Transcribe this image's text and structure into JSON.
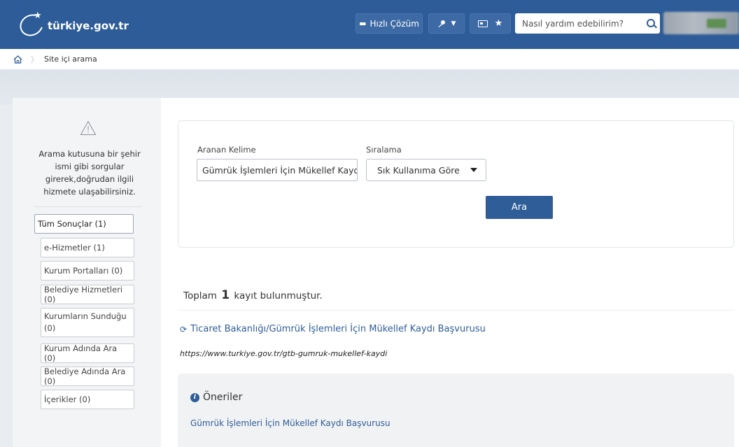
{
  "header": {
    "logo_text": "türkiye.gov.tr",
    "hizli_cozum": "Hızlı Çözüm",
    "search_placeholder": "Nasıl yardım edebilirim?"
  },
  "breadcrumb": {
    "current": "Site içi arama"
  },
  "sidebar": {
    "message": "Arama kutusuna bir şehir ismi gibi sorgular girerek,doğrudan ilgili hizmete ulaşabilirsiniz.",
    "filters": [
      {
        "label": "Tüm Sonuçlar (1)"
      },
      {
        "label": "e-Hizmetler (1)"
      },
      {
        "label": "Kurum Portalları (0)"
      },
      {
        "label": "Belediye Hizmetleri (0)"
      },
      {
        "label": "Kurumların Sunduğu (0)"
      },
      {
        "label": "Kurum Adında Ara (0)"
      },
      {
        "label": "Belediye Adında Ara (0)"
      },
      {
        "label": "İçerikler (0)"
      }
    ]
  },
  "search_form": {
    "keyword_label": "Aranan Kelime",
    "keyword_value": "Gümrük İşlemleri İçin Mükellef Kaydı Başvurusu",
    "sort_label": "Sıralama",
    "sort_value": "Sık Kullanıma Göre",
    "search_button": "Ara"
  },
  "results": {
    "total_prefix": "Toplam",
    "total_count": "1",
    "total_suffix": "kayıt bulunmuştur.",
    "items": [
      {
        "title": "Ticaret Bakanlığı/Gümrük İşlemleri İçin Mükellef Kaydı Başvurusu",
        "url": "https://www.turkiye.gov.tr/gtb-gumruk-mukellef-kaydi"
      }
    ]
  },
  "suggestions": {
    "title": "Öneriler",
    "items": [
      {
        "label": "Gümrük İşlemleri İçin Mükellef Kaydı Başvurusu"
      }
    ]
  },
  "colors": {
    "header_bg": "#2d5c98",
    "link": "#2f5d98",
    "button": "#2f5d98"
  }
}
